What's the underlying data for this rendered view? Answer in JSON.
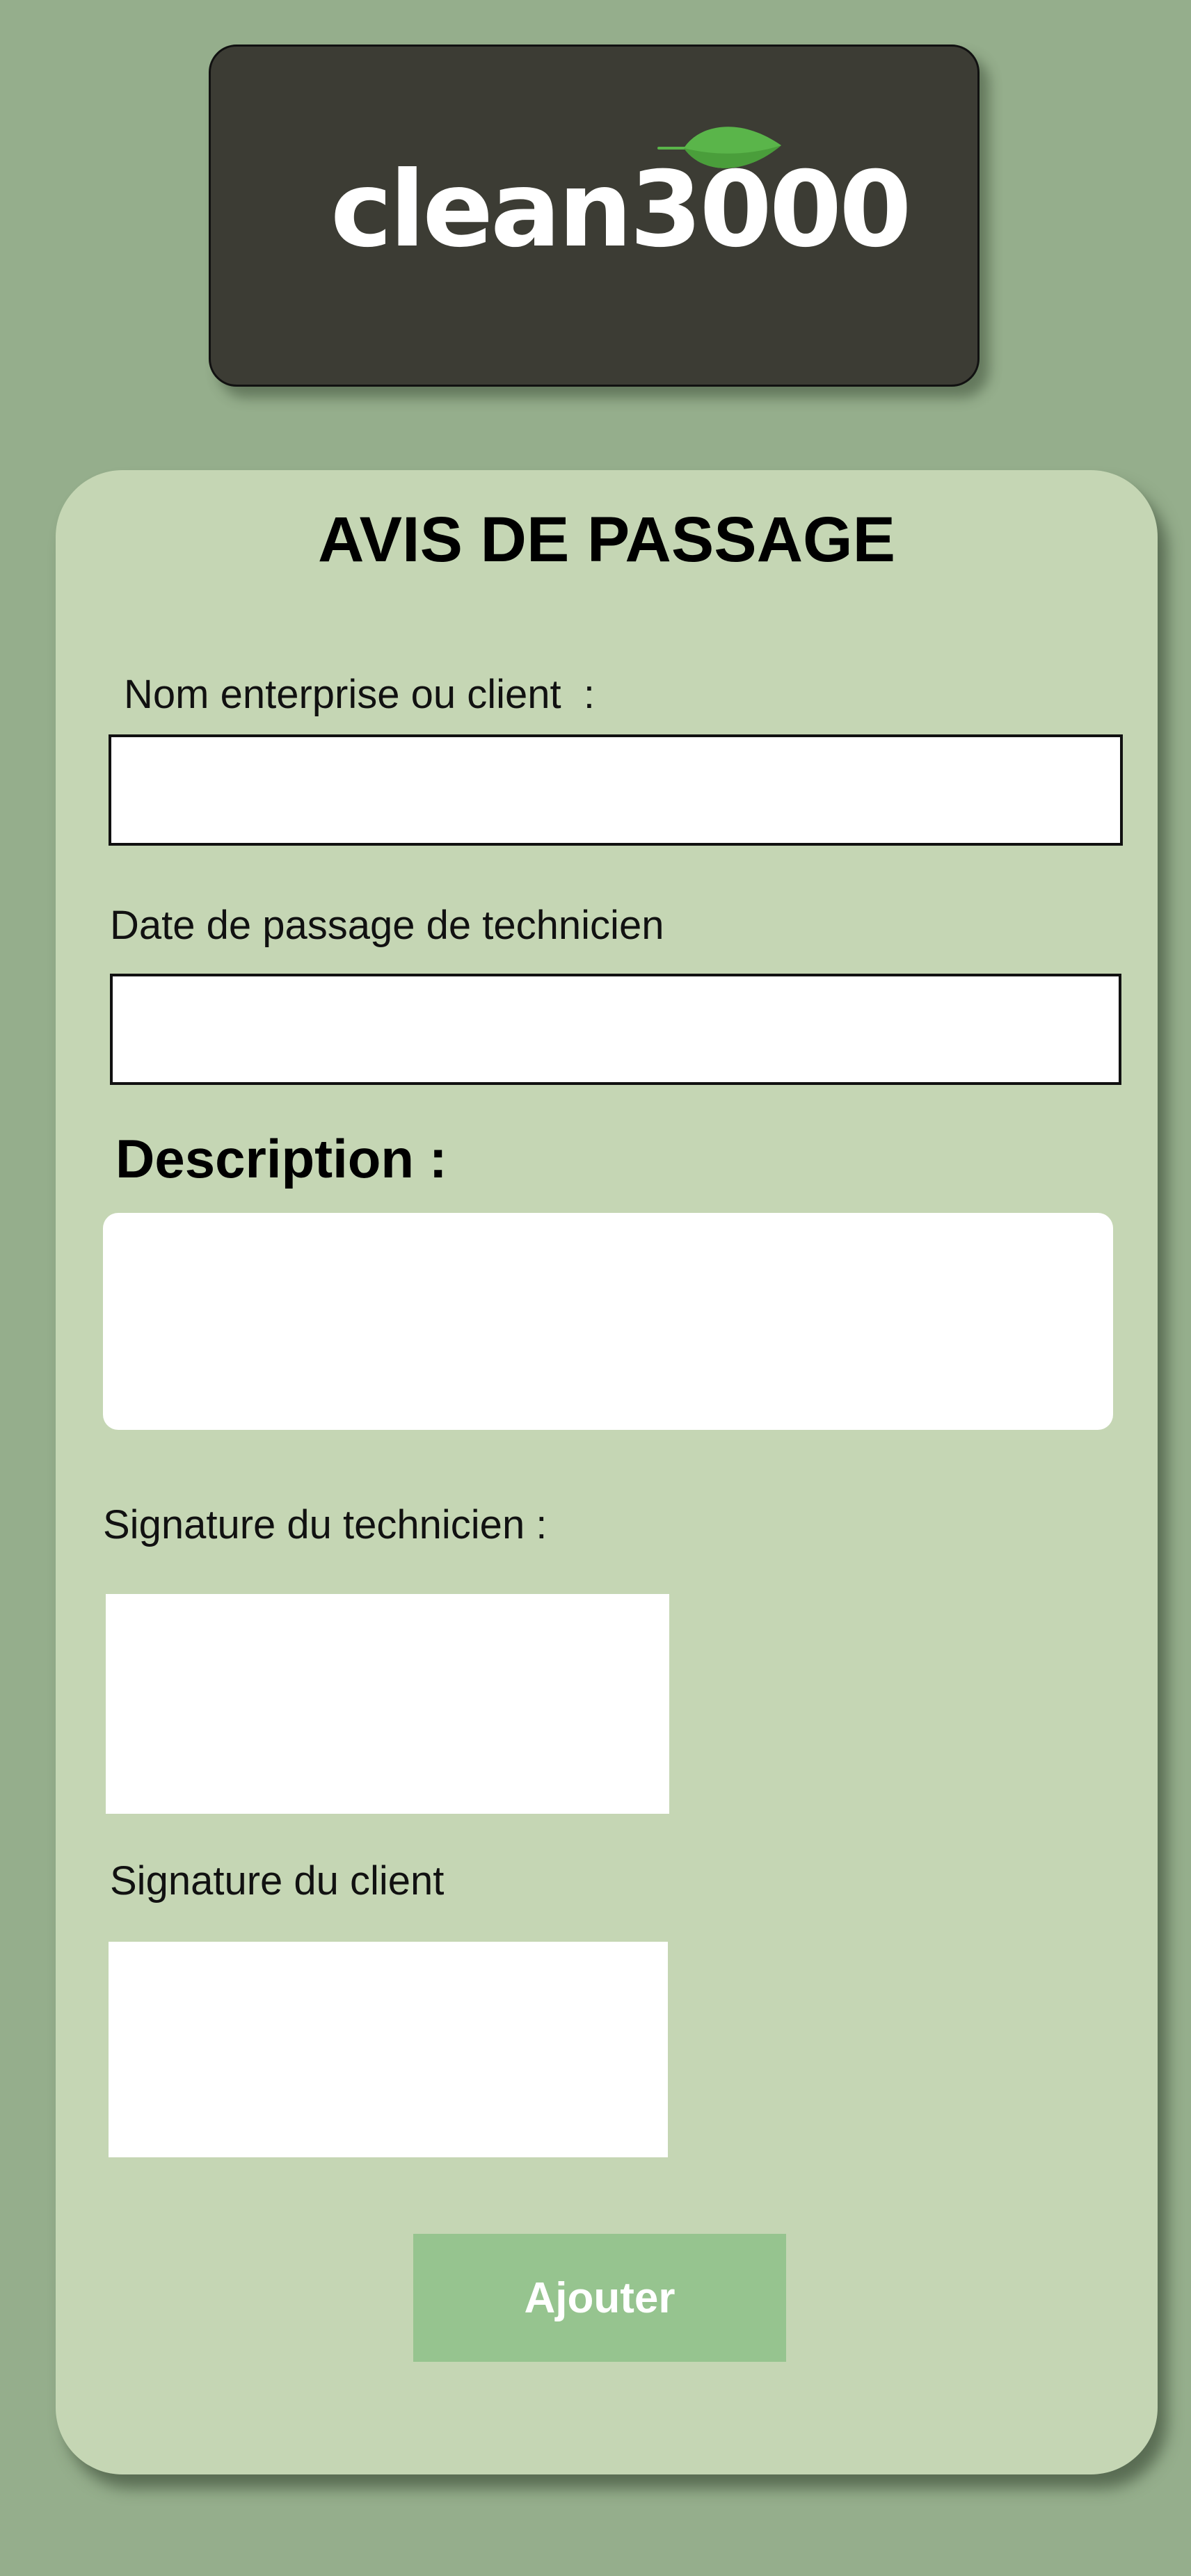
{
  "logo": {
    "wordmark": "clean3000",
    "icon": "leaf-icon",
    "leaf_color": "#5ab54a"
  },
  "form": {
    "title": "AVIS DE PASSAGE",
    "client_name": {
      "label": "Nom enterprise ou client  :",
      "value": ""
    },
    "visit_date": {
      "label": "Date de passage de technicien",
      "value": ""
    },
    "description": {
      "heading": "Description :",
      "value": ""
    },
    "technician_signature": {
      "label": "Signature du technicien :"
    },
    "client_signature": {
      "label": "Signature du client"
    },
    "submit_label": "Ajouter"
  },
  "colors": {
    "background": "#95ae8c",
    "card": "#c5d6b4",
    "logo_card": "#3c3c34",
    "button": "#96c48f"
  }
}
